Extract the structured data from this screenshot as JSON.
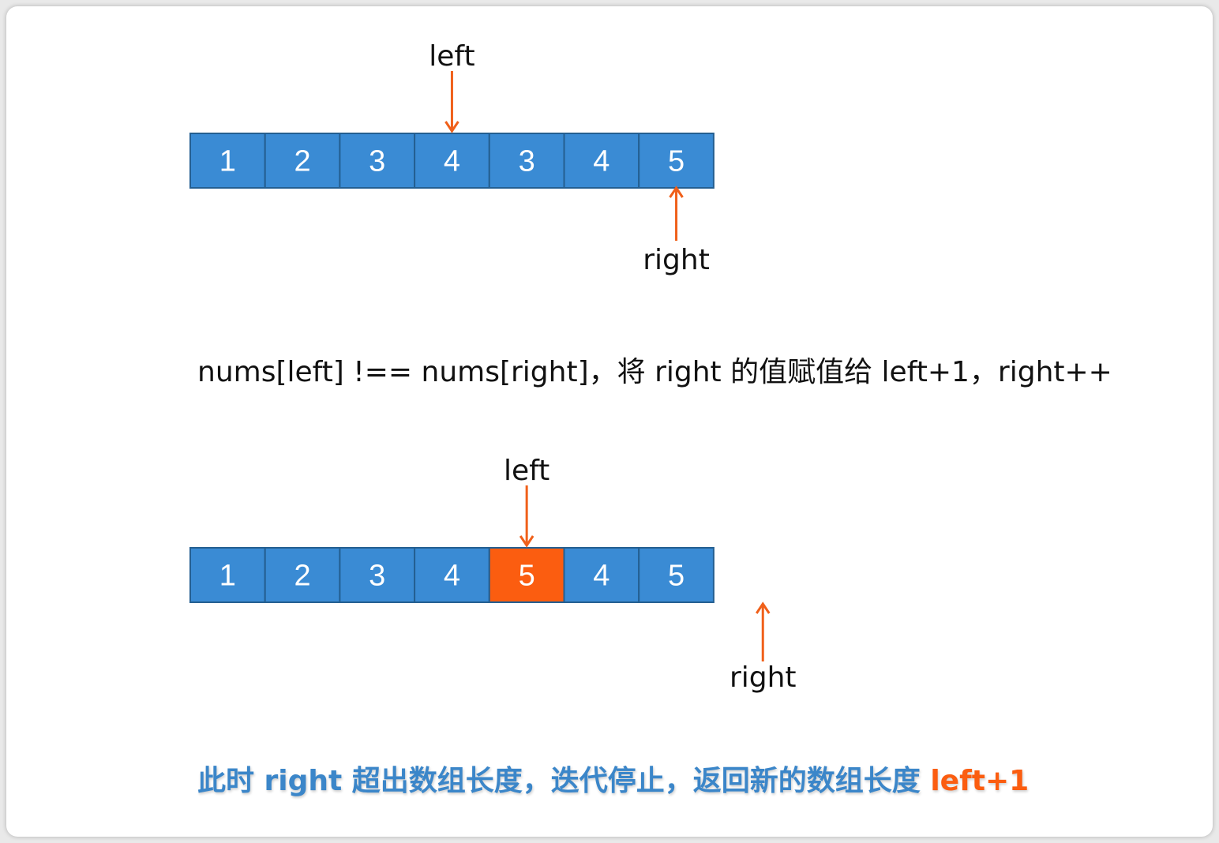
{
  "colors": {
    "cell": "#3a8bd4",
    "cell_border": "#245f91",
    "highlight": "#fb5d10",
    "arrow": "#f0601a"
  },
  "step1": {
    "array": [
      1,
      2,
      3,
      4,
      3,
      4,
      5
    ],
    "highlight_index": null,
    "left_label": "left",
    "right_label": "right",
    "left_index": 3,
    "right_index": 6
  },
  "description": "nums[left] !== nums[right]，将 right 的值赋值给 left+1，right++",
  "step2": {
    "array": [
      1,
      2,
      3,
      4,
      5,
      4,
      5
    ],
    "highlight_index": 4,
    "left_label": "left",
    "right_label": "right",
    "left_index": 4,
    "right_index": 7
  },
  "conclusion": {
    "text": "此时 right 超出数组长度，迭代停止，返回新的数组长度 ",
    "highlight": "left+1"
  }
}
